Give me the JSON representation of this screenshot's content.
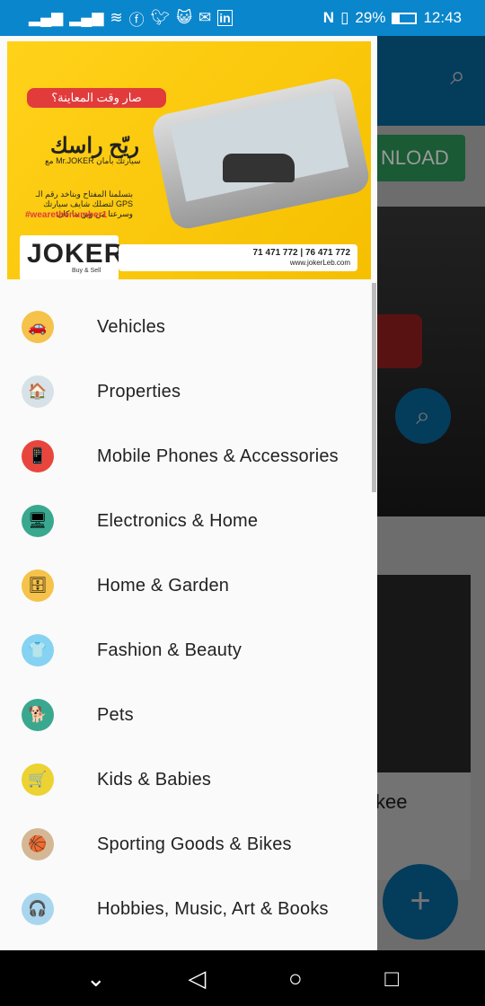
{
  "status_bar": {
    "battery": "29%",
    "time": "12:43",
    "left_icons": [
      "signal-icon",
      "signal-icon",
      "wifi-icon",
      "facebook-icon",
      "twitter-icon",
      "cat-app-icon",
      "mail-icon",
      "linkedin-icon"
    ],
    "right_icons": [
      "nfc-icon",
      "vibrate-icon",
      "battery-icon"
    ]
  },
  "background_app": {
    "download_label": "NLOAD",
    "card_text": "kee",
    "fab_label": "+"
  },
  "banner": {
    "headline_ar": "صار وقت المعاينة؟",
    "title_ar": "ريّح راسك",
    "subtitle_ar": "مع Mr.JOKER سيارتك بأمان",
    "body_ar": "بتسلمنا المفتاح وبتاخد رقم الـ GPS لتضلك شايف سيارتك وسرعتا من وين ما كان",
    "hashtag": "#wearethenumber1",
    "logo": "JOKER",
    "logo_sub": "Buy & Sell",
    "phones": "71 471 772 | 76 471 772",
    "website": "www.jokerLeb.com"
  },
  "menu": [
    {
      "label": "Vehicles",
      "icon": "car-icon",
      "color": "#f5c24a",
      "glyph": "🚗"
    },
    {
      "label": "Properties",
      "icon": "house-icon",
      "color": "#d6e2e8",
      "glyph": "🏠"
    },
    {
      "label": "Mobile Phones & Accessories",
      "icon": "mobile-phone-icon",
      "color": "#e8463c",
      "glyph": "📱"
    },
    {
      "label": "Electronics & Home",
      "icon": "monitor-icon",
      "color": "#3aa88f",
      "glyph": "🖥"
    },
    {
      "label": "Home & Garden",
      "icon": "furniture-icon",
      "color": "#f5c24a",
      "glyph": "🗄"
    },
    {
      "label": "Fashion & Beauty",
      "icon": "shirt-icon",
      "color": "#86d2f2",
      "glyph": "👕"
    },
    {
      "label": "Pets",
      "icon": "dog-icon",
      "color": "#3aa88f",
      "glyph": "🐕"
    },
    {
      "label": "Kids & Babies",
      "icon": "stroller-icon",
      "color": "#ecd232",
      "glyph": "🛒"
    },
    {
      "label": "Sporting Goods & Bikes",
      "icon": "basketball-icon",
      "color": "#d4b896",
      "glyph": "🏀"
    },
    {
      "label": "Hobbies, Music, Art & Books",
      "icon": "headphones-icon",
      "color": "#a8d6ee",
      "glyph": "🎧"
    }
  ],
  "nav_bar": {
    "down": "⌄",
    "back": "◁",
    "home": "○",
    "recents": "□"
  }
}
